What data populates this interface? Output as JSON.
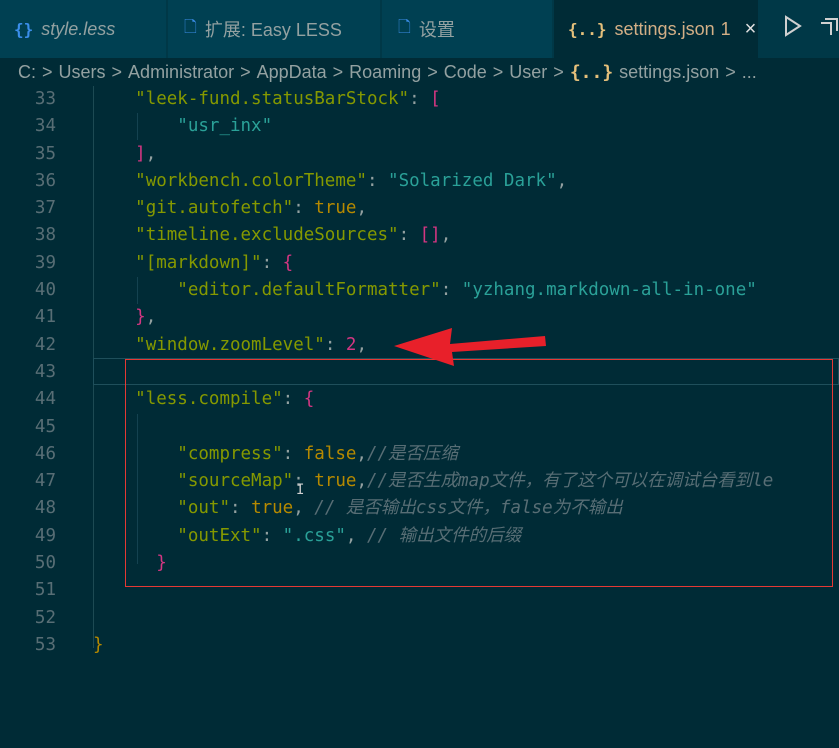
{
  "tabs": [
    {
      "icon": "less",
      "label": "style.less",
      "italic": true,
      "active": false
    },
    {
      "icon": "file",
      "label": "扩展: Easy LESS",
      "italic": false,
      "active": false
    },
    {
      "icon": "file",
      "label": "设置",
      "italic": false,
      "active": false
    },
    {
      "icon": "json",
      "label": "settings.json",
      "badge": "1",
      "active": true
    }
  ],
  "tab_icons": {
    "less": "{}",
    "json": "{..}",
    "file": "🗋"
  },
  "close_glyph": "×",
  "breadcrumb": [
    "C:",
    "Users",
    "Administrator",
    "AppData",
    "Roaming",
    "Code",
    "User",
    "settings.json",
    "..."
  ],
  "line_numbers": [
    "33",
    "34",
    "35",
    "36",
    "37",
    "38",
    "39",
    "40",
    "41",
    "42",
    "43",
    "44",
    "45",
    "46",
    "47",
    "48",
    "49",
    "50",
    "51",
    "52",
    "53"
  ],
  "code": {
    "l33_key": "\"leek-fund.statusBarStock\"",
    "l33_rest": ": ",
    "l34_str": "\"usr_inx\"",
    "l36_key": "\"workbench.colorTheme\"",
    "l36_str": "\"Solarized Dark\"",
    "l37_key": "\"git.autofetch\"",
    "l37_val": "true",
    "l38_key": "\"timeline.excludeSources\"",
    "l38_val": "[]",
    "l39_key": "\"[markdown]\"",
    "l40_key": "\"editor.defaultFormatter\"",
    "l40_str": "\"yzhang.markdown-all-in-one\"",
    "l42_key": "\"window.zoomLevel\"",
    "l42_val": "2",
    "l44_key": "\"less.compile\"",
    "l46_key": "\"compress\"",
    "l46_val": "false",
    "l46_cmt": "//是否压缩",
    "l47_key": "\"sourceMap\"",
    "l47_val": "true",
    "l47_cmt": "//是否生成map文件，有了这个可以在调试台看到le",
    "l48_key": "\"out\"",
    "l48_val": "true",
    "l48_cmt": "// 是否输出css文件，false为不输出",
    "l49_key": "\"outExt\"",
    "l49_str": "\".css\"",
    "l49_cmt": "// 输出文件的后缀"
  }
}
